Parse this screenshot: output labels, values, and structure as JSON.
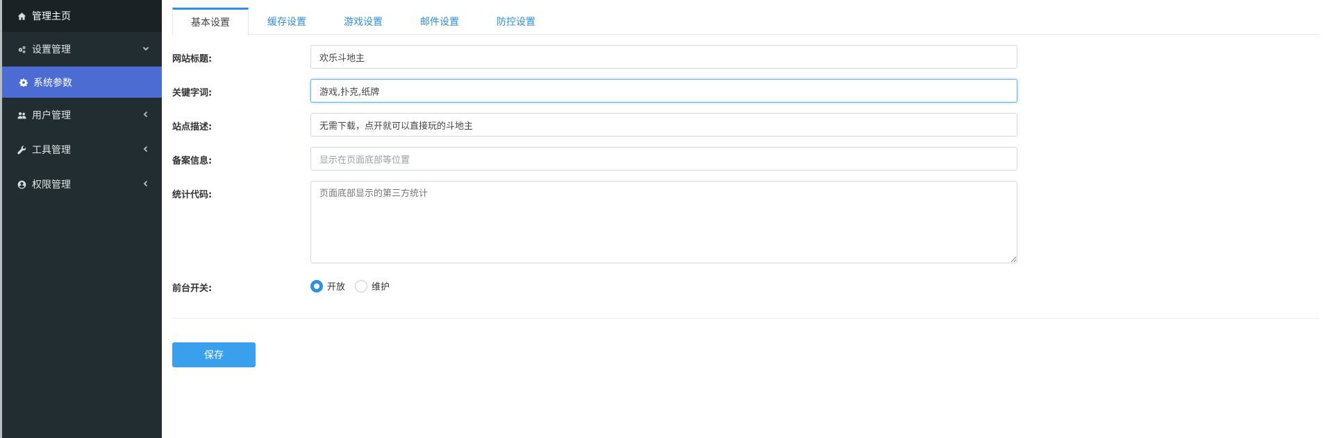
{
  "sidebar": {
    "home": {
      "label": "管理主页",
      "icon": "home-icon"
    },
    "settings": {
      "label": "设置管理",
      "icon": "cogs-icon"
    },
    "settings_sub": {
      "label": "系统参数",
      "icon": "gear-icon"
    },
    "users": {
      "label": "用户管理",
      "icon": "users-icon"
    },
    "tools": {
      "label": "工具管理",
      "icon": "wrench-icon"
    },
    "permissions": {
      "label": "权限管理",
      "icon": "user-circle-icon"
    }
  },
  "tabs": [
    {
      "label": "基本设置",
      "active": true
    },
    {
      "label": "缓存设置"
    },
    {
      "label": "游戏设置"
    },
    {
      "label": "邮件设置"
    },
    {
      "label": "防控设置"
    }
  ],
  "form": {
    "site_title": {
      "label": "网站标题:",
      "value": "欢乐斗地主"
    },
    "keywords": {
      "label": "关键字词:",
      "value": "游戏,扑克,纸牌"
    },
    "description": {
      "label": "站点描述:",
      "value": "无需下载，点开就可以直接玩的斗地主"
    },
    "icp": {
      "label": "备案信息:",
      "placeholder": "显示在页面底部等位置"
    },
    "stats_code": {
      "label": "统计代码:",
      "placeholder": "页面底部显示的第三方统计"
    },
    "frontend_switch": {
      "label": "前台开关:",
      "options": [
        {
          "label": "开放",
          "checked": true
        },
        {
          "label": "维护",
          "checked": false
        }
      ]
    }
  },
  "save_label": "保存",
  "colors": {
    "sidebar_bg": "#222d32",
    "sidebar_active": "#4c6cd4",
    "accent": "#2e90e0",
    "save_button": "#3aa0ee"
  }
}
